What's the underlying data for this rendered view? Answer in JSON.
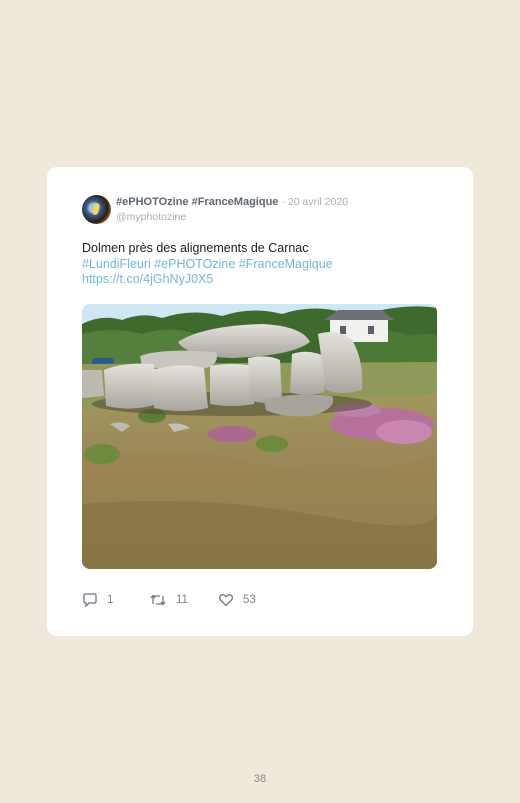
{
  "tweet": {
    "display_name": "#ePHOTOzine #FranceMagique",
    "date": "· 20 avril 2020",
    "handle": "@myphotozine",
    "text": "Dolmen près des alignements de Carnac",
    "hashtags": "#LundiFleuri #ePHOTOzine #FranceMagique",
    "link": "https://t.co/4jGhNyJ0X5",
    "photo_icon": "dolmen-photo",
    "actions": {
      "reply_count": "1",
      "retweet_count": "11",
      "like_count": "53"
    }
  },
  "colors": {
    "page_background": "#efe9dc",
    "card_background": "#ffffff",
    "link": "#74b4e0"
  },
  "page_number": "38"
}
